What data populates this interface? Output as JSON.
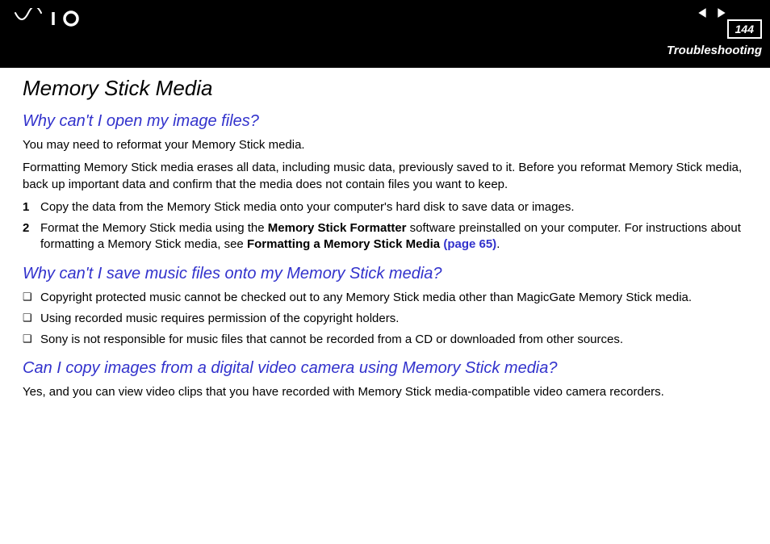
{
  "header": {
    "page_number": "144",
    "section": "Troubleshooting"
  },
  "logo_name": "VAIO",
  "content": {
    "title": "Memory Stick Media",
    "q1": {
      "heading": "Why can't I open my image files?",
      "p1": "You may need to reformat your Memory Stick media.",
      "p2": "Formatting Memory Stick media erases all data, including music data, previously saved to it. Before you reformat Memory Stick media, back up important data and confirm that the media does not contain files you want to keep.",
      "step1_num": "1",
      "step1": "Copy the data from the Memory Stick media onto your computer's hard disk to save data or images.",
      "step2_num": "2",
      "step2_a": "Format the Memory Stick media using the ",
      "step2_b": "Memory Stick Formatter",
      "step2_c": " software preinstalled on your computer. For instructions about formatting a Memory Stick media, see ",
      "step2_d": "Formatting a Memory Stick Media",
      "step2_link": " (page 65)",
      "step2_e": "."
    },
    "q2": {
      "heading": "Why can't I save music files onto my Memory Stick media?",
      "b1": "Copyright protected music cannot be checked out to any Memory Stick media other than MagicGate Memory Stick media.",
      "b2": "Using recorded music requires permission of the copyright holders.",
      "b3": "Sony is not responsible for music files that cannot be recorded from a CD or downloaded from other sources."
    },
    "q3": {
      "heading": "Can I copy images from a digital video camera using Memory Stick media?",
      "p1": "Yes, and you can view video clips that you have recorded with Memory Stick media-compatible video camera recorders."
    }
  }
}
